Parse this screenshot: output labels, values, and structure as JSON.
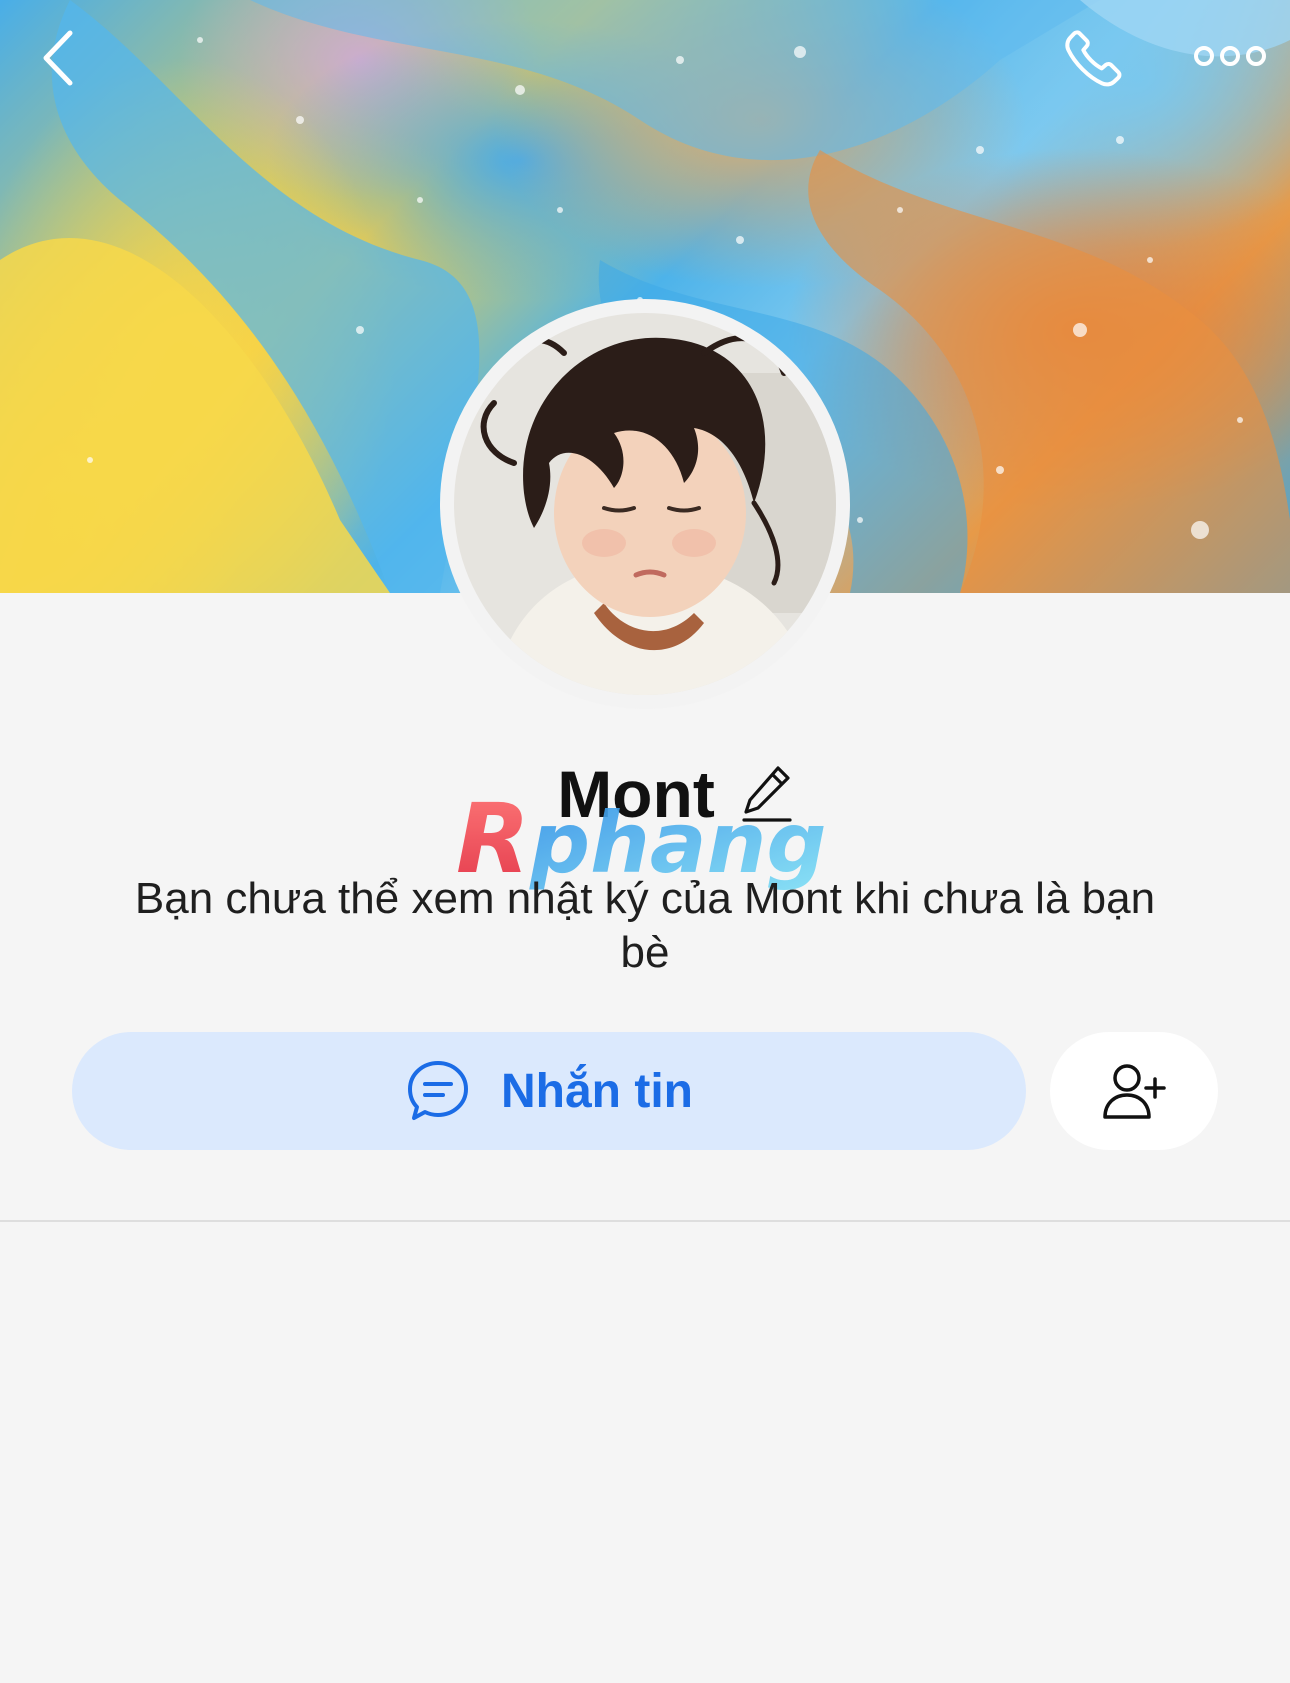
{
  "profile": {
    "name": "Mont",
    "notice": "Bạn chưa thể xem nhật ký của Mont khi chưa là bạn bè"
  },
  "actions": {
    "message_label": "Nhắn tin"
  },
  "watermark": {
    "text": "Rphang"
  },
  "icons": {
    "back": "chevron-left-icon",
    "call": "phone-icon",
    "more": "more-dots-icon",
    "edit": "pencil-icon",
    "message": "chat-bubble-icon",
    "add_friend": "add-friend-icon"
  },
  "colors": {
    "accent": "#1b6ce6",
    "message_button_bg": "#dbe9fd",
    "page_bg": "#f5f5f5"
  }
}
